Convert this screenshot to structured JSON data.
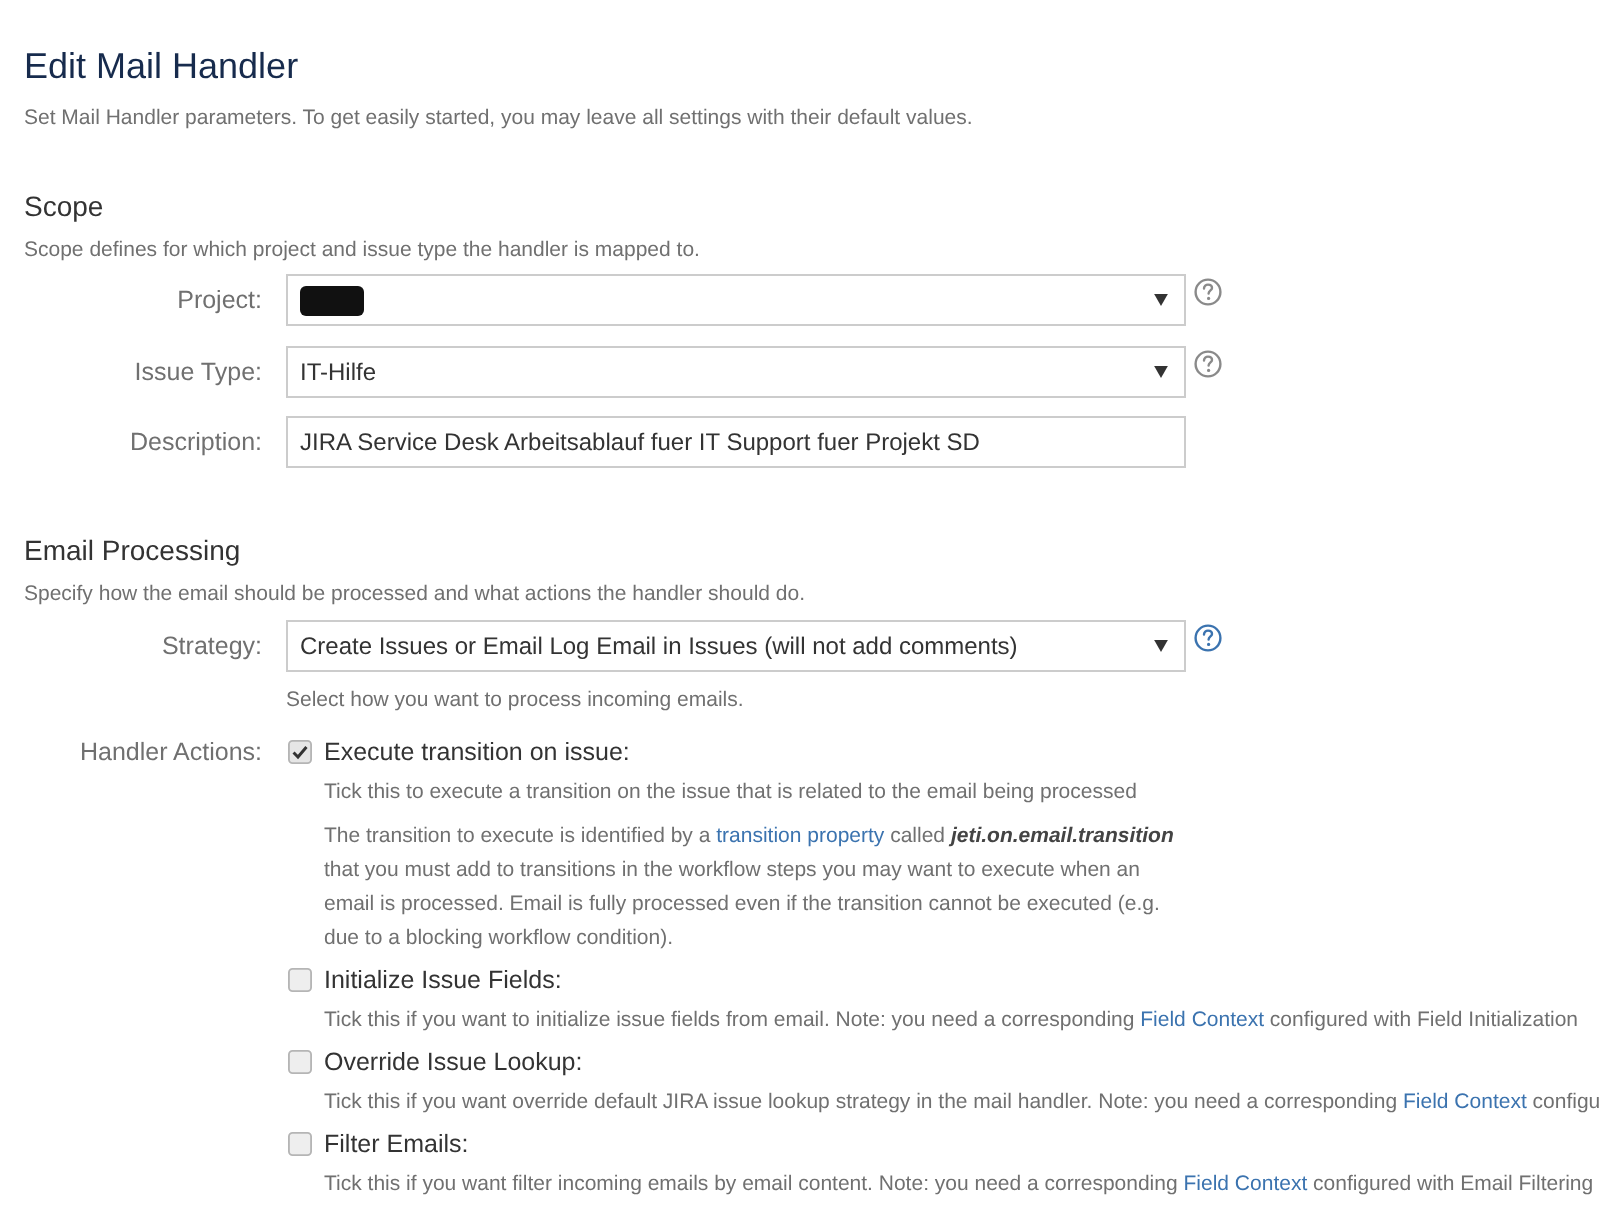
{
  "page": {
    "title": "Edit Mail Handler",
    "subtitle": "Set Mail Handler parameters. To get easily started, you may leave all settings with their default values."
  },
  "scope": {
    "heading": "Scope",
    "description": "Scope defines for which project and issue type the handler is mapped to.",
    "fields": [
      {
        "kind": "select",
        "label": "Project:",
        "redacted": true,
        "help": {
          "active": false
        }
      },
      {
        "kind": "select",
        "label": "Issue Type:",
        "value": "IT-Hilfe",
        "help": {
          "active": false
        }
      },
      {
        "kind": "text",
        "label": "Description:",
        "value": "JIRA Service Desk Arbeitsablauf fuer IT Support fuer Projekt SD"
      }
    ]
  },
  "email_processing": {
    "heading": "Email Processing",
    "description": "Specify how the email should be processed and what actions the handler should do.",
    "strategy": {
      "label": "Strategy:",
      "value": "Create Issues or Email Log Email in Issues (will not add comments)",
      "help": {
        "active": true
      },
      "hint": "Select how you want to process incoming emails."
    },
    "handler_actions": {
      "label": "Handler Actions:",
      "actions": [
        {
          "label": "Execute transition on issue:",
          "checked": true,
          "paragraphs": [
            [
              {
                "kind": "text",
                "text": "Tick this to execute a transition on the issue that is related to the email being processed"
              }
            ],
            [
              {
                "kind": "text",
                "text": "The transition to execute is identified by a "
              },
              {
                "kind": "link",
                "text": "transition property"
              },
              {
                "kind": "text",
                "text": " called "
              },
              {
                "kind": "emphasis",
                "text": "jeti.on.email.transition"
              },
              {
                "kind": "text",
                "text": " that you must add to transitions in the workflow steps you may want to execute when an email is processed. Email is fully processed even if the transition cannot be executed (e.g. due to a blocking workflow condition)."
              }
            ]
          ]
        },
        {
          "label": "Initialize Issue Fields:",
          "checked": false,
          "paragraphs": [
            [
              {
                "kind": "text",
                "text": "Tick this if you want to initialize issue fields from email. Note: you need a corresponding "
              },
              {
                "kind": "link",
                "text": "Field Context"
              },
              {
                "kind": "text",
                "text": " configured with Field Initialization"
              }
            ]
          ]
        },
        {
          "label": "Override Issue Lookup:",
          "checked": false,
          "paragraphs": [
            [
              {
                "kind": "text",
                "text": "Tick this if you want override default JIRA issue lookup strategy in the mail handler. Note: you need a corresponding "
              },
              {
                "kind": "link",
                "text": "Field Context"
              },
              {
                "kind": "text",
                "text": " configu"
              }
            ]
          ]
        },
        {
          "label": "Filter Emails:",
          "checked": false,
          "paragraphs": [
            [
              {
                "kind": "text",
                "text": "Tick this if you want filter incoming emails by email content. Note: you need a corresponding "
              },
              {
                "kind": "link",
                "text": "Field Context"
              },
              {
                "kind": "text",
                "text": " configured with Email Filtering"
              }
            ]
          ]
        }
      ]
    }
  }
}
